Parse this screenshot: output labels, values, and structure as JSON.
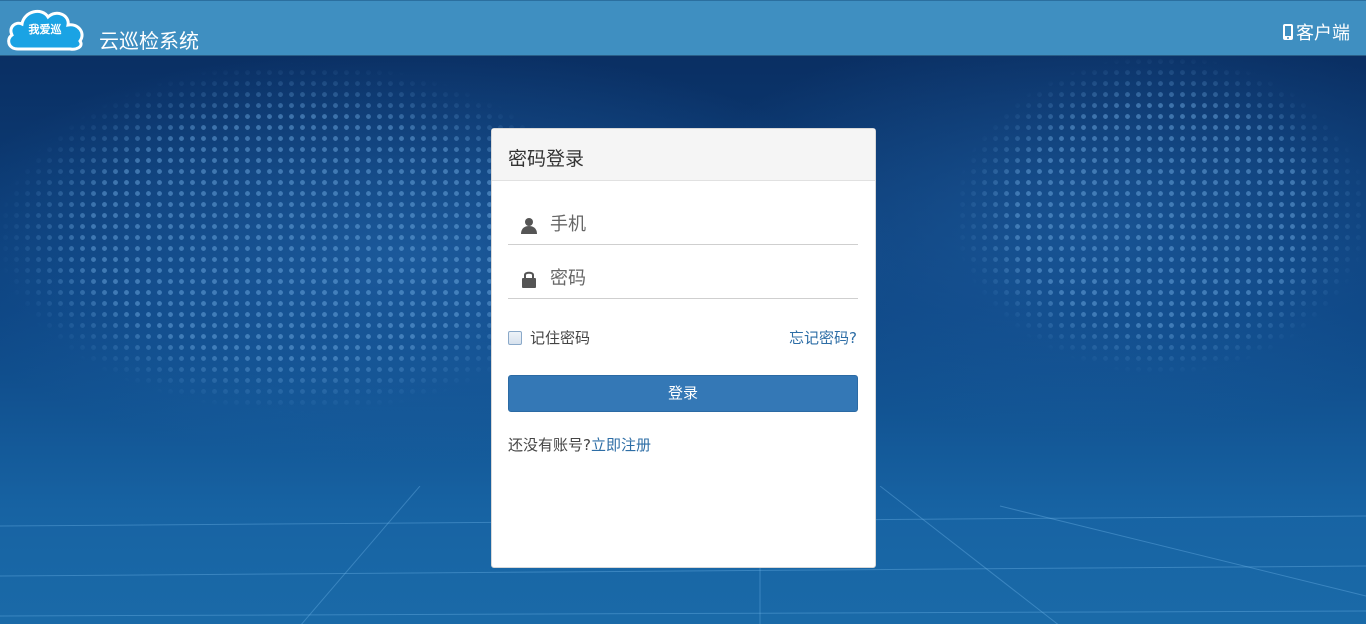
{
  "header": {
    "logo_text": "我爱巡",
    "app_title": "云巡检系统",
    "client_label": "客户端"
  },
  "login": {
    "title": "密码登录",
    "phone_placeholder": "手机",
    "password_placeholder": "密码",
    "remember_label": "记住密码",
    "forgot_label": "忘记密码?",
    "submit_label": "登录",
    "no_account_text": "还没有账号?",
    "register_label": "立即注册"
  },
  "colors": {
    "header_bg": "#3f8fc1",
    "button_bg": "#3478b6",
    "link": "#2e6ea6"
  },
  "icons": {
    "logo": "cloud-logo-icon",
    "client": "phone-icon",
    "phone_field": "user-icon",
    "password_field": "lock-icon"
  }
}
